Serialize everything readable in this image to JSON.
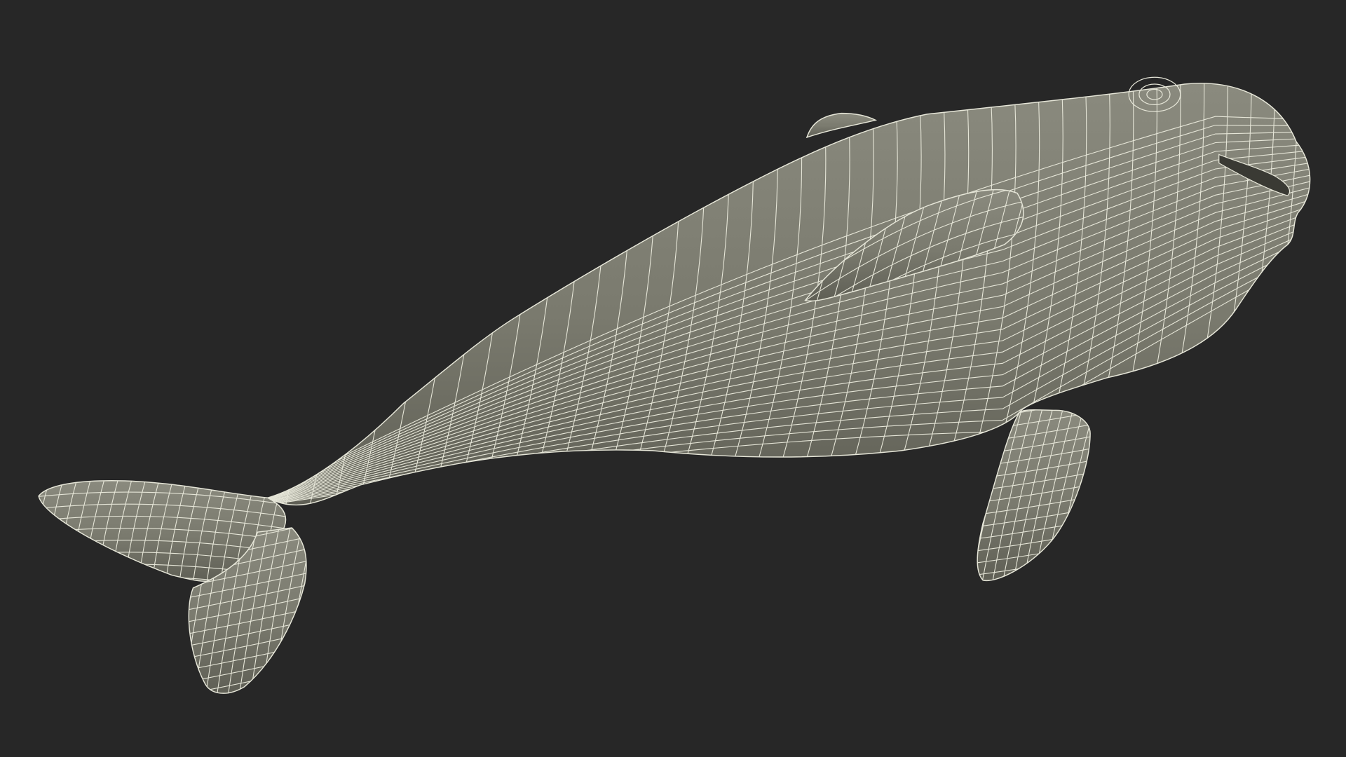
{
  "scene": {
    "background_color": "#272727",
    "subject": "whale-wireframe-model",
    "surface_color": "#7a7a6e",
    "shadow_color": "#5f5f55",
    "highlight_color": "#8a8a7e",
    "wire_color": "#e6e6d8",
    "render_style": "wireframe-over-shaded"
  }
}
